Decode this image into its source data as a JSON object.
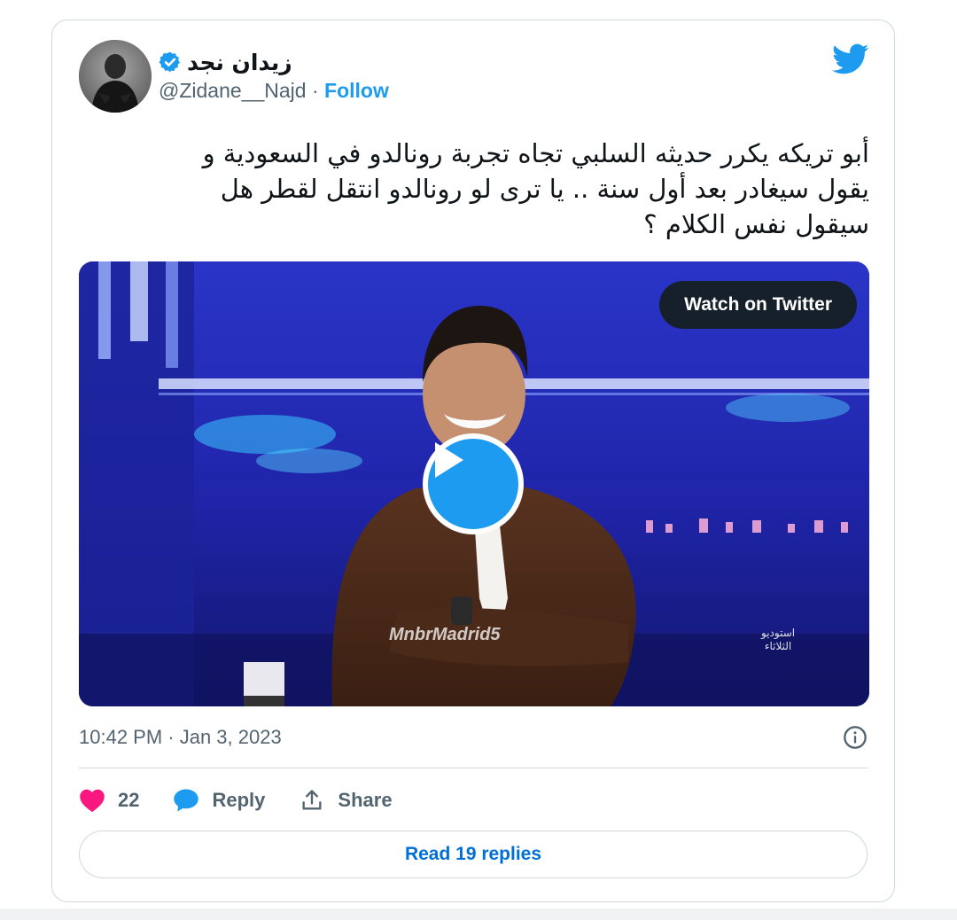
{
  "author": {
    "name": "زيدان نجد",
    "handle": "@Zidane__Najd",
    "separator": " · ",
    "follow_label": "Follow",
    "verified": true
  },
  "tweet": {
    "text_lines": [
      "أبو تريكه يكرر حديثه السلبي تجاه تجربة رونالدو في السعودية و",
      "يقول سيغادر بعد أول سنة  .. يا ترى لو رونالدو انتقل لقطر هل",
      "سيقول نفس الكلام ؟"
    ]
  },
  "media": {
    "watch_label": "Watch on Twitter",
    "watermark": "MnbrMadrid5",
    "studio_line1": "استوديو",
    "studio_line2": "الثلاثاء",
    "play_icon": "play-icon"
  },
  "meta": {
    "timestamp": "10:42 PM · Jan 3, 2023"
  },
  "actions": {
    "like_count": "22",
    "reply_label": "Reply",
    "share_label": "Share"
  },
  "read_replies_label": "Read 19 replies",
  "colors": {
    "twitter_blue": "#1d9bf0",
    "like_pink": "#f91880",
    "text_dark": "#0f1419",
    "text_muted": "#536471",
    "border": "#cfd9de",
    "link_blue": "#006fd6"
  }
}
